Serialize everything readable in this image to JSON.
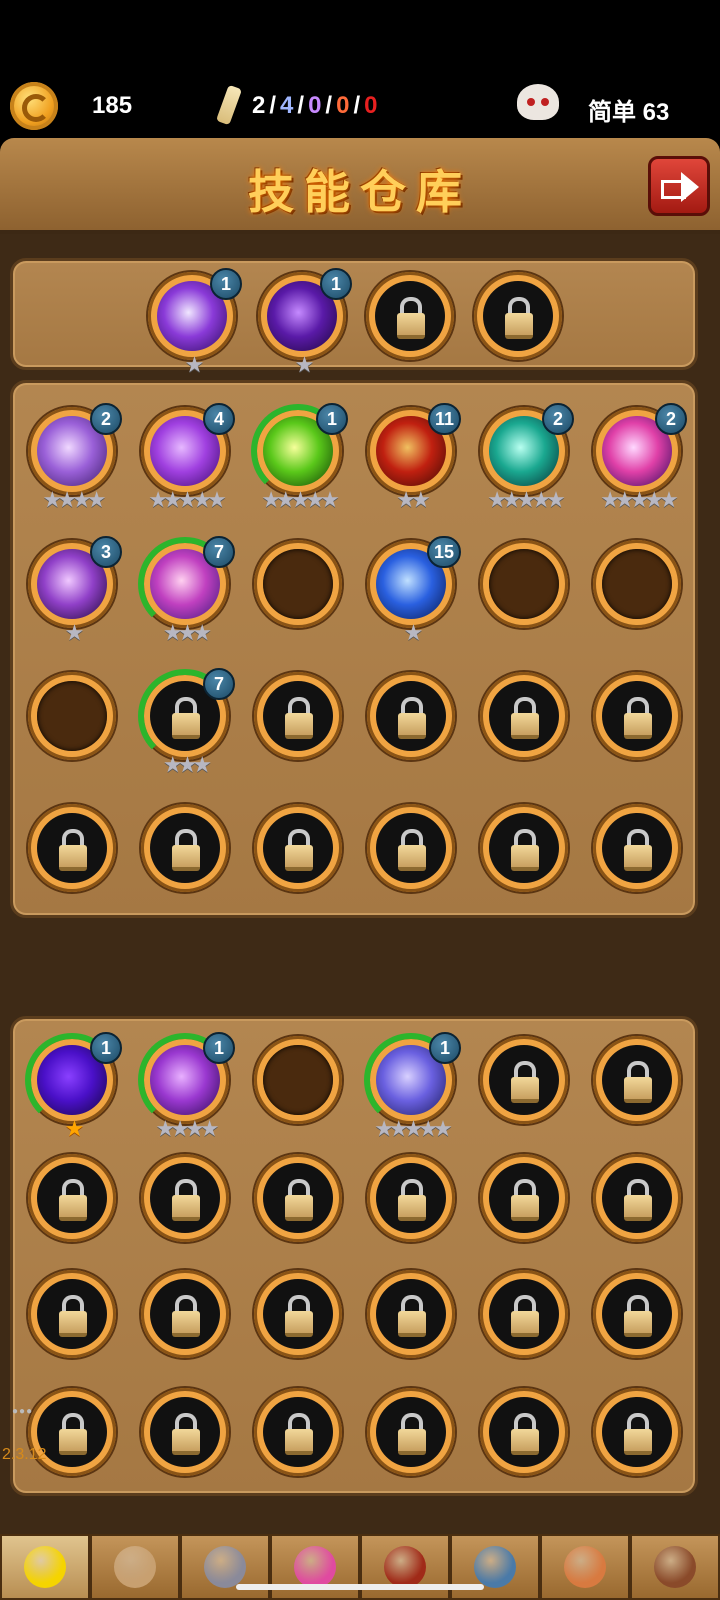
{
  "status": {
    "gold": "185",
    "scrolls": [
      "2",
      "4",
      "0",
      "0",
      "0"
    ],
    "scroll_colors": [
      "#ffffff",
      "#9fb6ff",
      "#c88aff",
      "#ff6b3a",
      "#e82020"
    ],
    "scroll_sep": "/",
    "difficulty": "简单 63",
    "icons": [
      "coin-icon",
      "scroll-icon",
      "skull-icon"
    ]
  },
  "header": {
    "title": "技能仓库",
    "exit_icon": "exit-arrow-icon"
  },
  "equipped": {
    "slots": [
      {
        "state": "skill",
        "level": "1",
        "stars": 1,
        "colors": [
          "#f0e6ff",
          "#8a3ad8",
          "#2a0a5a"
        ]
      },
      {
        "state": "skill",
        "level": "1",
        "stars": 1,
        "colors": [
          "#c58aff",
          "#5a1aa8",
          "#1a0636"
        ]
      },
      {
        "state": "locked"
      },
      {
        "state": "locked"
      }
    ]
  },
  "inventory_a": {
    "slots": [
      {
        "state": "skill",
        "level": "2",
        "stars": 4,
        "colors": [
          "#f0d8ff",
          "#9a60d8",
          "#3a1a66"
        ]
      },
      {
        "state": "skill",
        "level": "4",
        "stars": 5,
        "colors": [
          "#e6b8ff",
          "#a040e0",
          "#3a0a6a"
        ]
      },
      {
        "state": "skill",
        "level": "1",
        "stars": 5,
        "colors": [
          "#f6ff9a",
          "#5ac81a",
          "#0e3a06"
        ],
        "progress": true
      },
      {
        "state": "skill",
        "level": "11",
        "stars": 2,
        "colors": [
          "#f0c060",
          "#c02010",
          "#3a0a04"
        ]
      },
      {
        "state": "skill",
        "level": "2",
        "stars": 5,
        "colors": [
          "#b8fff0",
          "#1aa890",
          "#062a30"
        ]
      },
      {
        "state": "skill",
        "level": "2",
        "stars": 5,
        "colors": [
          "#ffd8ff",
          "#e040a8",
          "#2a0a5a"
        ]
      },
      {
        "state": "skill",
        "level": "3",
        "stars": 1,
        "colors": [
          "#f0c8ff",
          "#9040c8",
          "#1a0630"
        ]
      },
      {
        "state": "skill",
        "level": "7",
        "stars": 3,
        "colors": [
          "#ffd0f0",
          "#c040c0",
          "#3a1a7a"
        ],
        "progress": true
      },
      {
        "state": "empty"
      },
      {
        "state": "skill",
        "level": "15",
        "stars": 1,
        "colors": [
          "#c0e0ff",
          "#2a60e0",
          "#06164a"
        ]
      },
      {
        "state": "empty"
      },
      {
        "state": "empty"
      },
      {
        "state": "empty"
      },
      {
        "state": "locked",
        "level": "7",
        "stars": 3,
        "progress": true
      },
      {
        "state": "locked"
      },
      {
        "state": "locked"
      },
      {
        "state": "locked"
      },
      {
        "state": "locked"
      },
      {
        "state": "locked"
      },
      {
        "state": "locked"
      },
      {
        "state": "locked"
      },
      {
        "state": "locked"
      },
      {
        "state": "locked"
      },
      {
        "state": "locked"
      }
    ]
  },
  "inventory_b": {
    "slots": [
      {
        "state": "skill",
        "level": "1",
        "stars": 1,
        "gold_stars": true,
        "colors": [
          "#8a40ff",
          "#4a10c8",
          "#12063a"
        ],
        "progress": true
      },
      {
        "state": "skill",
        "level": "1",
        "stars": 4,
        "colors": [
          "#e8b0ff",
          "#9a38d0",
          "#2a0a50"
        ],
        "progress": true
      },
      {
        "state": "empty"
      },
      {
        "state": "skill",
        "level": "1",
        "stars": 5,
        "colors": [
          "#d8d0ff",
          "#6a60e0",
          "#1a1a5a"
        ],
        "progress": true
      },
      {
        "state": "locked"
      },
      {
        "state": "locked"
      },
      {
        "state": "locked"
      },
      {
        "state": "locked"
      },
      {
        "state": "locked"
      },
      {
        "state": "locked"
      },
      {
        "state": "locked"
      },
      {
        "state": "locked"
      },
      {
        "state": "locked"
      },
      {
        "state": "locked"
      },
      {
        "state": "locked"
      },
      {
        "state": "locked"
      },
      {
        "state": "locked"
      },
      {
        "state": "locked"
      },
      {
        "state": "locked"
      },
      {
        "state": "locked"
      },
      {
        "state": "locked"
      },
      {
        "state": "locked"
      },
      {
        "state": "locked"
      },
      {
        "state": "locked"
      }
    ]
  },
  "version": "2.3.12",
  "nav": {
    "items": [
      {
        "name": "hero-tab",
        "icon": "hero-icon",
        "color": "#f5d400",
        "active": true
      },
      {
        "name": "pet-tab",
        "icon": "pet-icon",
        "color": "#c8a070"
      },
      {
        "name": "forge-tab",
        "icon": "hammer-icon",
        "color": "#8a8a9a"
      },
      {
        "name": "orb-tab",
        "icon": "orb-icon",
        "color": "#e04aa0"
      },
      {
        "name": "book-tab",
        "icon": "book-icon",
        "color": "#a02a18"
      },
      {
        "name": "map-tab",
        "icon": "map-icon",
        "color": "#4a7aa8"
      },
      {
        "name": "quest-tab",
        "icon": "scroll-character-icon",
        "color": "#d87a40"
      },
      {
        "name": "settings-tab",
        "icon": "gear-icon",
        "color": "#8a4a2a"
      }
    ]
  }
}
